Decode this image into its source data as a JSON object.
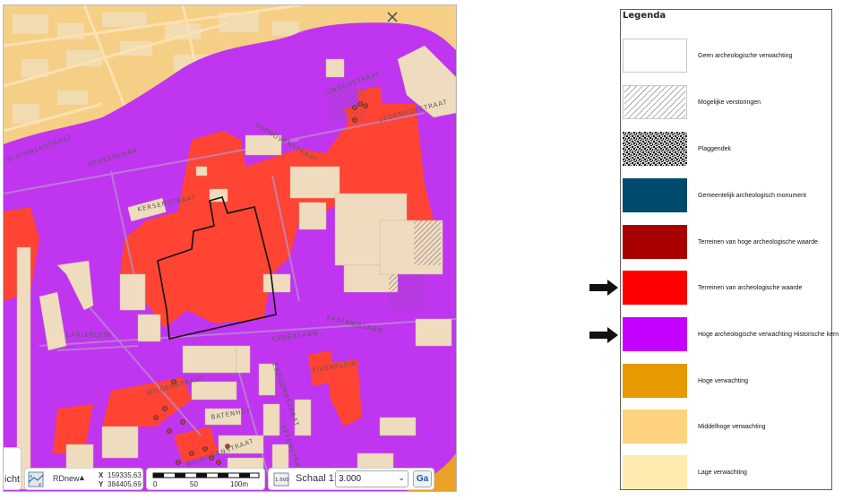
{
  "map": {
    "street_labels": [
      "BEUKENLAAN",
      "PLATANENSTRAAT",
      "KERSENSTRAAT",
      "TOPHOVENSTRAAT",
      "LINDENSTRAAT",
      "LEDENHOFSTRAAT",
      "LARIXPLEIN",
      "CEDERLAAN",
      "KASTANJELAAN",
      "EIKENPLEIN",
      "ESDOORNSTRAAT",
      "BATENHOF",
      "EFFENSTRAAT",
      "WILGENSTRAAT",
      "MEIDOORNSTRAAT"
    ],
    "toolbar": {
      "left_partial_text": "icht",
      "crs_icon": "map-grid-icon",
      "crs_name": "RDnew",
      "crs_arrow": "▲",
      "x_label": "X",
      "x_value": "159335,63",
      "y_label": "Y",
      "y_value": "384405,69",
      "scale_ticks": [
        "0",
        "50",
        "100m"
      ],
      "zoom_icon": "scale-ratio-icon",
      "scale_label": "Schaal 1:",
      "scale_value": "3.000",
      "go_button": "Ga"
    }
  },
  "legend": {
    "title": "Legenda",
    "items": [
      {
        "label": "Geen archeologische verwachting",
        "fill": "#ffffff",
        "pattern": "none"
      },
      {
        "label": "Mogelijke verstoringen",
        "fill": "#ffffff",
        "pattern": "hatch"
      },
      {
        "label": "Plaggendek",
        "fill": "#ffffff",
        "pattern": "noise"
      },
      {
        "label": "Gemeentelijk archeologisch monument",
        "fill": "#004a6e",
        "pattern": "none"
      },
      {
        "label": "Terreinen van hoge archeologische waarde",
        "fill": "#a80000",
        "pattern": "none"
      },
      {
        "label": "Terreinen van archeologische waarde",
        "fill": "#ff0000",
        "pattern": "none"
      },
      {
        "label": "Hoge archeologische verwachting Historische kern",
        "fill": "#c400ff",
        "pattern": "none"
      },
      {
        "label": "Hoge verwachting",
        "fill": "#e69a00",
        "pattern": "none"
      },
      {
        "label": "Middelhoge verwachting",
        "fill": "#ffd37f",
        "pattern": "none"
      },
      {
        "label": "Lage verwachting",
        "fill": "#ffebaf",
        "pattern": "none"
      }
    ]
  },
  "arrows": {
    "icon": "arrow-right-icon",
    "points_to": [
      "Terreinen van archeologische waarde",
      "Hoge archeologische verwachting Historische kern"
    ]
  },
  "colors": {
    "purple": "#c035f0",
    "red": "#ff4433",
    "orange_bg": "#f6cf86",
    "buildings": "#efdcbf"
  }
}
